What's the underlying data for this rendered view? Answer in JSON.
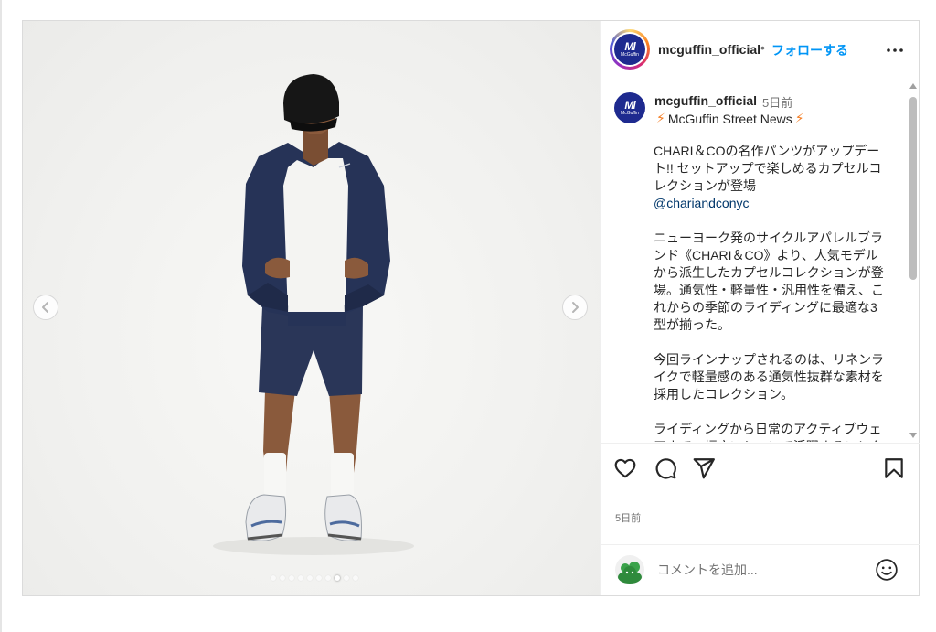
{
  "account": {
    "username": "mcguffin_official",
    "logo_mark": "Ml",
    "logo_word": "McGuffin"
  },
  "header": {
    "separator": "•",
    "follow_label": "フォローする"
  },
  "caption": {
    "username": "mcguffin_official",
    "time": "5日前",
    "subtitle_icon": "⚡",
    "subtitle": "McGuffin Street News",
    "paragraph1": "CHARI＆COの名作パンツがアップデート!! セットアップで楽しめるカプセルコレクションが登場",
    "mention": "@chariandconyc",
    "paragraph2": "ニューヨーク発のサイクルアパレルブランド《CHARI＆CO》より、人気モデルから派生したカプセルコレクションが登場。通気性・軽量性・汎用性を備え、これからの季節のライディングに最適な3型が揃った。",
    "paragraph3": "今回ラインナップされるのは、リネンライクで軽量感のある通気性抜群な素材を採用したコレクション。",
    "paragraph4": "ライディングから日常のアクティブウェアまで、幅広いシーンで活躍するコレクション。"
  },
  "footer": {
    "time": "5日前"
  },
  "comment": {
    "placeholder": "コメントを追加..."
  },
  "icons": {
    "prev": "chevron-left-icon",
    "next": "chevron-right-icon",
    "more": "more-icon",
    "like": "heart-icon",
    "comment": "comment-icon",
    "share": "share-icon",
    "save": "bookmark-icon",
    "emoji": "emoji-icon"
  },
  "carousel": {
    "total_slides": 10,
    "active_index": 7
  },
  "colors": {
    "follow": "#0095f6",
    "brand": "#1e2a8f",
    "mention": "#00376b",
    "bolt": "#f47b20",
    "muted": "#737373"
  }
}
